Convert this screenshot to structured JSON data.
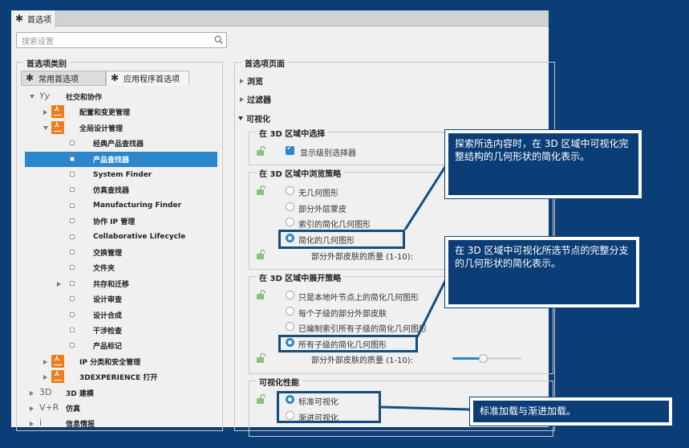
{
  "window": {
    "tab_label": "首选项",
    "search_placeholder": "搜索设置"
  },
  "left_panel": {
    "group_title": "首选项类别",
    "tabs": [
      {
        "label": "常用首选项",
        "active": false
      },
      {
        "label": "应用程序首选项",
        "active": true
      }
    ],
    "tree": [
      {
        "label": "社交和协作",
        "level": 0,
        "expanded": true,
        "icon": "social-collab-icon"
      },
      {
        "label": "配置和变更管理",
        "level": 1,
        "expanded": false,
        "icon": "app-icon"
      },
      {
        "label": "全局设计管理",
        "level": 1,
        "expanded": true,
        "icon": "app-icon"
      },
      {
        "label": "经典产品查找器",
        "level": 2
      },
      {
        "label": "产品查找器",
        "level": 2,
        "selected": true
      },
      {
        "label": "System Finder",
        "level": 2
      },
      {
        "label": "仿真查找器",
        "level": 2
      },
      {
        "label": "Manufacturing Finder",
        "level": 2
      },
      {
        "label": "协作 IP 管理",
        "level": 2
      },
      {
        "label": "Collaborative Lifecycle",
        "level": 2
      },
      {
        "label": "交换管理",
        "level": 2
      },
      {
        "label": "文件夹",
        "level": 2
      },
      {
        "label": "共存和迁移",
        "level": 2,
        "expandable": true
      },
      {
        "label": "设计审查",
        "level": 2
      },
      {
        "label": "设计合成",
        "level": 2
      },
      {
        "label": "干涉检查",
        "level": 2
      },
      {
        "label": "产品标记",
        "level": 2
      },
      {
        "label": "IP 分类和安全管理",
        "level": 1,
        "expanded": false,
        "icon": "app-icon"
      },
      {
        "label": "3DEXPERIENCE 打开",
        "level": 1,
        "expanded": false,
        "icon": "app-icon"
      },
      {
        "label": "3D 建模",
        "level": 0,
        "expanded": false,
        "icon_text": "3D"
      },
      {
        "label": "仿真",
        "level": 0,
        "expanded": false,
        "icon_text": "V+R"
      },
      {
        "label": "信息情报",
        "level": 0,
        "expanded": false,
        "icon_text": "i"
      }
    ]
  },
  "right_panel": {
    "group_title": "首选项页面",
    "sections": [
      {
        "label": "浏览",
        "expanded": false
      },
      {
        "label": "过滤器",
        "expanded": false
      },
      {
        "label": "可视化",
        "expanded": true
      }
    ],
    "select_group": {
      "title": "在 3D 区域中选择",
      "checkbox_label": "显示级别选择器",
      "checked": true
    },
    "browse_group": {
      "title": "在 3D 区域中浏览策略",
      "options": [
        "无几何图形",
        "部分外层蒙皮",
        "索引的简化几何图形",
        "简化的几何图形"
      ],
      "selected": 3,
      "quality_label": "部分外部皮肤的质量 (1-10):"
    },
    "expand_group": {
      "title": "在 3D 区域中展开策略",
      "options": [
        "只是本地叶节点上的简化几何图形",
        "每个子级的部分外部皮肤",
        "已编制索引所有子级的简化几何图形",
        "所有子级的简化几何图形"
      ],
      "selected": 3,
      "quality_label": "部分外部皮肤的质量 (1-10):",
      "quality_value": 5
    },
    "perf_group": {
      "title": "可视化性能",
      "options": [
        "标准可视化",
        "渐进可视化"
      ],
      "selected": 0
    }
  },
  "callouts": [
    {
      "text": "探索所选内容时，在 3D 区域中可视化完整结构的几何形状的简化表示。"
    },
    {
      "text": "在 3D 区域中可视化所选节点的完整分支的几何形状的简化表示。"
    },
    {
      "text": "标准加载与渐进加载。"
    }
  ],
  "colors": {
    "background": "#0b3d77",
    "accent": "#2b86cc",
    "app_icon": "#f07c20",
    "highlight": "#134e7f"
  }
}
